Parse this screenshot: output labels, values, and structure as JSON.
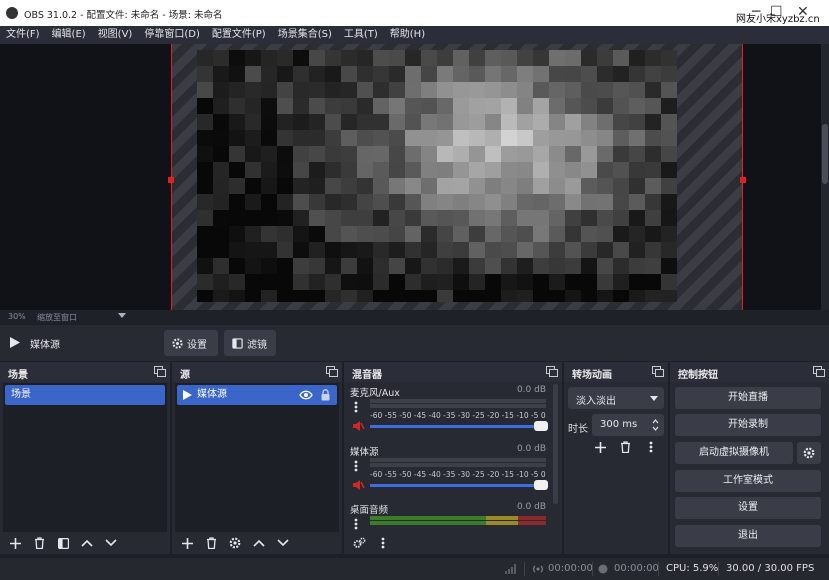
{
  "window": {
    "title": "OBS 31.0.2 - 配置文件: 未命名 - 场景: 未命名",
    "watermark": "网友小宋xyzbz.cn",
    "minimize": "─",
    "maximize": "☐",
    "close": "✕"
  },
  "menu": [
    "文件(F)",
    "编辑(E)",
    "视图(V)",
    "停靠窗口(D)",
    "配置文件(P)",
    "场景集合(S)",
    "工具(T)",
    "帮助(H)"
  ],
  "preview": {
    "zoom": "30%",
    "zoom_label": "缩放至窗口"
  },
  "source_controls": {
    "name": "媒体源",
    "settings_label": "设置",
    "filters_label": "滤镜"
  },
  "docks": {
    "scenes": {
      "title": "场景",
      "items": [
        "场景"
      ]
    },
    "sources": {
      "title": "源",
      "items": [
        "媒体源"
      ]
    },
    "mixer": {
      "title": "混音器",
      "channels": [
        {
          "name": "麦克风/Aux",
          "db": "0.0 dB"
        },
        {
          "name": "媒体源",
          "db": "0.0 dB"
        },
        {
          "name": "桌面音频",
          "db": "0.0 dB"
        }
      ],
      "ticks": "-60 -55 -50 -45 -40 -35 -30 -25 -20 -15 -10 -5 0"
    },
    "transitions": {
      "title": "转场动画",
      "selected": "淡入淡出",
      "duration_label": "时长",
      "duration_value": "300 ms"
    },
    "controls": {
      "title": "控制按钮",
      "buttons": [
        "开始直播",
        "开始录制",
        "启动虚拟摄像机",
        "工作室模式",
        "设置",
        "退出"
      ]
    }
  },
  "status": {
    "stream_time": "00:00:00",
    "record_time": "00:00:00",
    "cpu": "CPU: 5.9%",
    "fps": "30.00 / 30.00 FPS"
  },
  "colors": {
    "accent": "#3a65c9",
    "preview_border": "#e02020",
    "volume_bar": "#3b6de0"
  }
}
